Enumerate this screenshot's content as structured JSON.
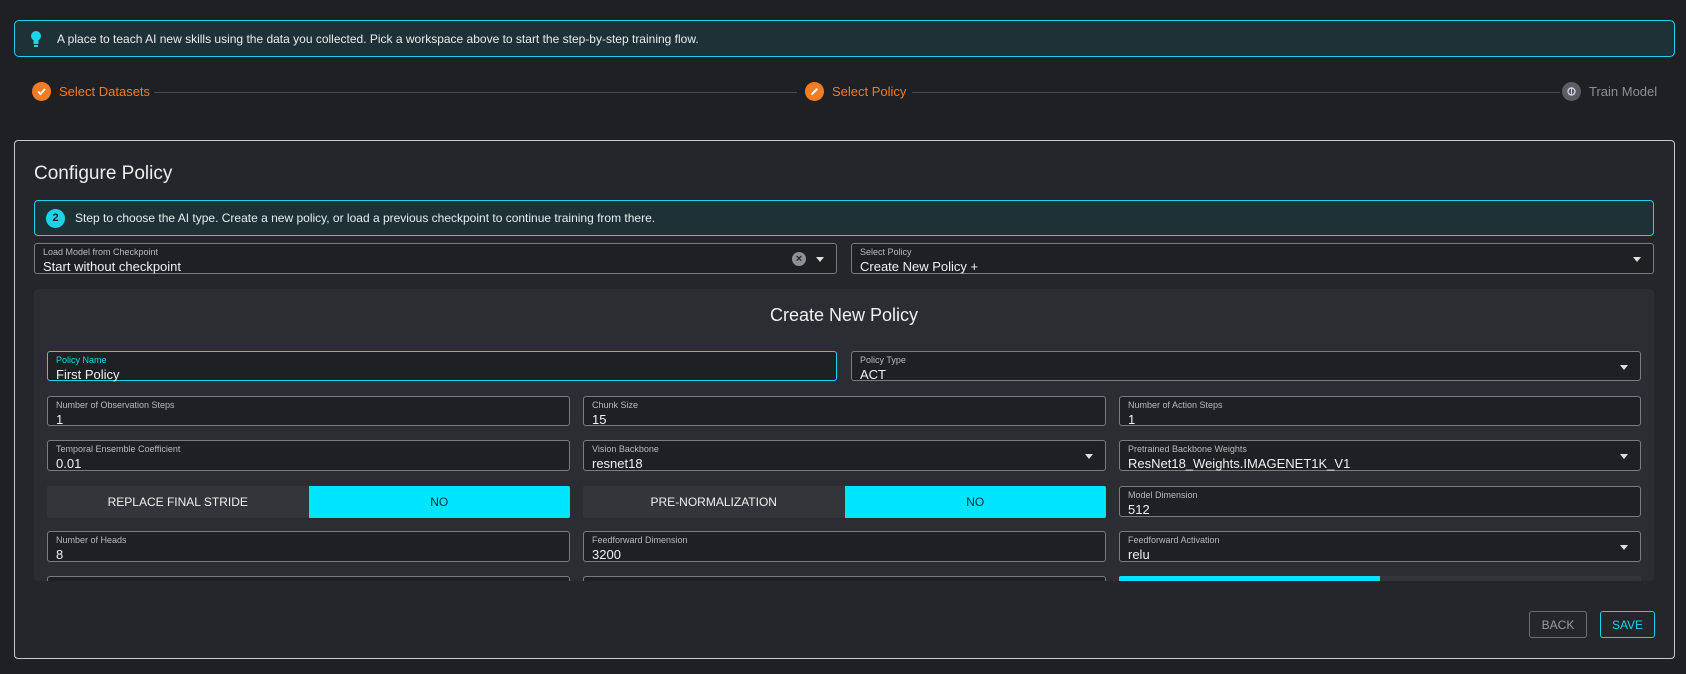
{
  "banner": {
    "text": "A place to teach AI new skills using the data you collected. Pick a workspace above to start the step-by-step training flow."
  },
  "stepper": {
    "steps": [
      {
        "label": "Select Datasets",
        "state": "done"
      },
      {
        "label": "Select Policy",
        "state": "active"
      },
      {
        "label": "Train Model",
        "state": "todo"
      }
    ]
  },
  "card": {
    "title": "Configure Policy",
    "info": {
      "number": "2",
      "text": "Step to choose the AI type. Create a new policy, or load a previous checkpoint to continue training from there."
    },
    "checkpoint": {
      "label": "Load Model from Checkpoint",
      "value": "Start without checkpoint"
    },
    "select_policy": {
      "label": "Select Policy",
      "value": "Create New Policy +"
    }
  },
  "create": {
    "title": "Create New Policy",
    "policy_name": {
      "label": "Policy Name",
      "value": "First Policy"
    },
    "policy_type": {
      "label": "Policy Type",
      "value": "ACT"
    },
    "obs_steps": {
      "label": "Number of Observation Steps",
      "value": "1"
    },
    "chunk_size": {
      "label": "Chunk Size",
      "value": "15"
    },
    "action_steps": {
      "label": "Number of Action Steps",
      "value": "1"
    },
    "temporal_coef": {
      "label": "Temporal Ensemble Coefficient",
      "value": "0.01"
    },
    "vision_backbone": {
      "label": "Vision Backbone",
      "value": "resnet18"
    },
    "pretrained_weights": {
      "label": "Pretrained Backbone Weights",
      "value": "ResNet18_Weights.IMAGENET1K_V1"
    },
    "replace_stride": {
      "label": "REPLACE FINAL STRIDE",
      "value": "NO"
    },
    "pre_norm": {
      "label": "PRE-NORMALIZATION",
      "value": "NO"
    },
    "model_dim": {
      "label": "Model Dimension",
      "value": "512"
    },
    "num_heads": {
      "label": "Number of Heads",
      "value": "8"
    },
    "ff_dim": {
      "label": "Feedforward Dimension",
      "value": "3200"
    },
    "ff_activation": {
      "label": "Feedforward Activation",
      "value": "relu"
    }
  },
  "actions": {
    "back": "BACK",
    "save": "SAVE"
  },
  "colors": {
    "accent": "#1fd3e6",
    "step_active": "#f57c22",
    "toggle_on": "#00e5ff"
  },
  "icons": {
    "banner": "lightbulb-icon",
    "done": "check-icon",
    "active": "pencil-icon",
    "todo": "brain-icon"
  }
}
